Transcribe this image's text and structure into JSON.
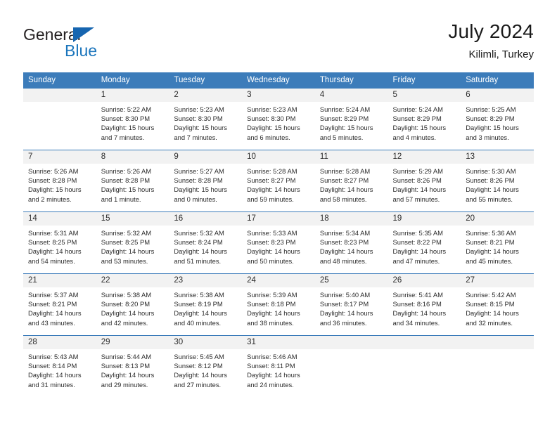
{
  "brand": {
    "name_part1": "General",
    "name_part2": "Blue",
    "accent_color": "#1b75bc",
    "triangle_color": "#1665b0"
  },
  "header": {
    "title": "July 2024",
    "subtitle": "Kilimli, Turkey"
  },
  "theme": {
    "header_row_bg": "#3c7cba",
    "daynum_bg": "#f2f2f2",
    "text_color": "#2b2b2b"
  },
  "weekday_headers": [
    "Sunday",
    "Monday",
    "Tuesday",
    "Wednesday",
    "Thursday",
    "Friday",
    "Saturday"
  ],
  "weeks": [
    [
      {
        "day": "",
        "sunrise": "",
        "sunset": "",
        "daylight1": "",
        "daylight2": "",
        "blank": true
      },
      {
        "day": "1",
        "sunrise": "Sunrise: 5:22 AM",
        "sunset": "Sunset: 8:30 PM",
        "daylight1": "Daylight: 15 hours",
        "daylight2": "and 7 minutes."
      },
      {
        "day": "2",
        "sunrise": "Sunrise: 5:23 AM",
        "sunset": "Sunset: 8:30 PM",
        "daylight1": "Daylight: 15 hours",
        "daylight2": "and 7 minutes."
      },
      {
        "day": "3",
        "sunrise": "Sunrise: 5:23 AM",
        "sunset": "Sunset: 8:30 PM",
        "daylight1": "Daylight: 15 hours",
        "daylight2": "and 6 minutes."
      },
      {
        "day": "4",
        "sunrise": "Sunrise: 5:24 AM",
        "sunset": "Sunset: 8:29 PM",
        "daylight1": "Daylight: 15 hours",
        "daylight2": "and 5 minutes."
      },
      {
        "day": "5",
        "sunrise": "Sunrise: 5:24 AM",
        "sunset": "Sunset: 8:29 PM",
        "daylight1": "Daylight: 15 hours",
        "daylight2": "and 4 minutes."
      },
      {
        "day": "6",
        "sunrise": "Sunrise: 5:25 AM",
        "sunset": "Sunset: 8:29 PM",
        "daylight1": "Daylight: 15 hours",
        "daylight2": "and 3 minutes."
      }
    ],
    [
      {
        "day": "7",
        "sunrise": "Sunrise: 5:26 AM",
        "sunset": "Sunset: 8:28 PM",
        "daylight1": "Daylight: 15 hours",
        "daylight2": "and 2 minutes."
      },
      {
        "day": "8",
        "sunrise": "Sunrise: 5:26 AM",
        "sunset": "Sunset: 8:28 PM",
        "daylight1": "Daylight: 15 hours",
        "daylight2": "and 1 minute."
      },
      {
        "day": "9",
        "sunrise": "Sunrise: 5:27 AM",
        "sunset": "Sunset: 8:28 PM",
        "daylight1": "Daylight: 15 hours",
        "daylight2": "and 0 minutes."
      },
      {
        "day": "10",
        "sunrise": "Sunrise: 5:28 AM",
        "sunset": "Sunset: 8:27 PM",
        "daylight1": "Daylight: 14 hours",
        "daylight2": "and 59 minutes."
      },
      {
        "day": "11",
        "sunrise": "Sunrise: 5:28 AM",
        "sunset": "Sunset: 8:27 PM",
        "daylight1": "Daylight: 14 hours",
        "daylight2": "and 58 minutes."
      },
      {
        "day": "12",
        "sunrise": "Sunrise: 5:29 AM",
        "sunset": "Sunset: 8:26 PM",
        "daylight1": "Daylight: 14 hours",
        "daylight2": "and 57 minutes."
      },
      {
        "day": "13",
        "sunrise": "Sunrise: 5:30 AM",
        "sunset": "Sunset: 8:26 PM",
        "daylight1": "Daylight: 14 hours",
        "daylight2": "and 55 minutes."
      }
    ],
    [
      {
        "day": "14",
        "sunrise": "Sunrise: 5:31 AM",
        "sunset": "Sunset: 8:25 PM",
        "daylight1": "Daylight: 14 hours",
        "daylight2": "and 54 minutes."
      },
      {
        "day": "15",
        "sunrise": "Sunrise: 5:32 AM",
        "sunset": "Sunset: 8:25 PM",
        "daylight1": "Daylight: 14 hours",
        "daylight2": "and 53 minutes."
      },
      {
        "day": "16",
        "sunrise": "Sunrise: 5:32 AM",
        "sunset": "Sunset: 8:24 PM",
        "daylight1": "Daylight: 14 hours",
        "daylight2": "and 51 minutes."
      },
      {
        "day": "17",
        "sunrise": "Sunrise: 5:33 AM",
        "sunset": "Sunset: 8:23 PM",
        "daylight1": "Daylight: 14 hours",
        "daylight2": "and 50 minutes."
      },
      {
        "day": "18",
        "sunrise": "Sunrise: 5:34 AM",
        "sunset": "Sunset: 8:23 PM",
        "daylight1": "Daylight: 14 hours",
        "daylight2": "and 48 minutes."
      },
      {
        "day": "19",
        "sunrise": "Sunrise: 5:35 AM",
        "sunset": "Sunset: 8:22 PM",
        "daylight1": "Daylight: 14 hours",
        "daylight2": "and 47 minutes."
      },
      {
        "day": "20",
        "sunrise": "Sunrise: 5:36 AM",
        "sunset": "Sunset: 8:21 PM",
        "daylight1": "Daylight: 14 hours",
        "daylight2": "and 45 minutes."
      }
    ],
    [
      {
        "day": "21",
        "sunrise": "Sunrise: 5:37 AM",
        "sunset": "Sunset: 8:21 PM",
        "daylight1": "Daylight: 14 hours",
        "daylight2": "and 43 minutes."
      },
      {
        "day": "22",
        "sunrise": "Sunrise: 5:38 AM",
        "sunset": "Sunset: 8:20 PM",
        "daylight1": "Daylight: 14 hours",
        "daylight2": "and 42 minutes."
      },
      {
        "day": "23",
        "sunrise": "Sunrise: 5:38 AM",
        "sunset": "Sunset: 8:19 PM",
        "daylight1": "Daylight: 14 hours",
        "daylight2": "and 40 minutes."
      },
      {
        "day": "24",
        "sunrise": "Sunrise: 5:39 AM",
        "sunset": "Sunset: 8:18 PM",
        "daylight1": "Daylight: 14 hours",
        "daylight2": "and 38 minutes."
      },
      {
        "day": "25",
        "sunrise": "Sunrise: 5:40 AM",
        "sunset": "Sunset: 8:17 PM",
        "daylight1": "Daylight: 14 hours",
        "daylight2": "and 36 minutes."
      },
      {
        "day": "26",
        "sunrise": "Sunrise: 5:41 AM",
        "sunset": "Sunset: 8:16 PM",
        "daylight1": "Daylight: 14 hours",
        "daylight2": "and 34 minutes."
      },
      {
        "day": "27",
        "sunrise": "Sunrise: 5:42 AM",
        "sunset": "Sunset: 8:15 PM",
        "daylight1": "Daylight: 14 hours",
        "daylight2": "and 32 minutes."
      }
    ],
    [
      {
        "day": "28",
        "sunrise": "Sunrise: 5:43 AM",
        "sunset": "Sunset: 8:14 PM",
        "daylight1": "Daylight: 14 hours",
        "daylight2": "and 31 minutes."
      },
      {
        "day": "29",
        "sunrise": "Sunrise: 5:44 AM",
        "sunset": "Sunset: 8:13 PM",
        "daylight1": "Daylight: 14 hours",
        "daylight2": "and 29 minutes."
      },
      {
        "day": "30",
        "sunrise": "Sunrise: 5:45 AM",
        "sunset": "Sunset: 8:12 PM",
        "daylight1": "Daylight: 14 hours",
        "daylight2": "and 27 minutes."
      },
      {
        "day": "31",
        "sunrise": "Sunrise: 5:46 AM",
        "sunset": "Sunset: 8:11 PM",
        "daylight1": "Daylight: 14 hours",
        "daylight2": "and 24 minutes."
      },
      {
        "day": "",
        "sunrise": "",
        "sunset": "",
        "daylight1": "",
        "daylight2": "",
        "blank": true
      },
      {
        "day": "",
        "sunrise": "",
        "sunset": "",
        "daylight1": "",
        "daylight2": "",
        "blank": true
      },
      {
        "day": "",
        "sunrise": "",
        "sunset": "",
        "daylight1": "",
        "daylight2": "",
        "blank": true
      }
    ]
  ]
}
